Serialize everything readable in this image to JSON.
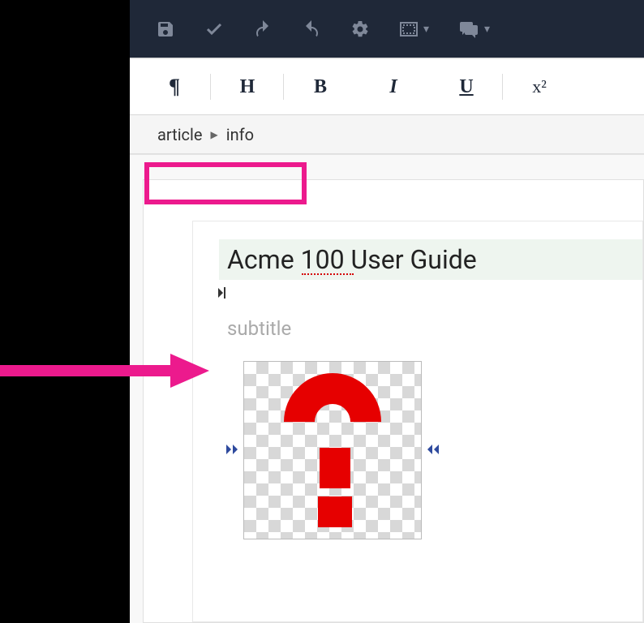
{
  "toolbar": {
    "save_icon": "save",
    "check_icon": "check",
    "undo_icon": "undo",
    "redo_icon": "redo",
    "settings_icon": "gear",
    "present_icon": "present",
    "chat_icon": "chat"
  },
  "format": {
    "paragraph_label": "¶",
    "heading_label": "H",
    "bold_label": "B",
    "italic_label": "I",
    "underline_label": "U",
    "superscript_label": "x²"
  },
  "breadcrumb": {
    "item1": "article",
    "item2": "info"
  },
  "document": {
    "title": "Acme 100 User Guide",
    "subtitle_placeholder": "subtitle"
  }
}
